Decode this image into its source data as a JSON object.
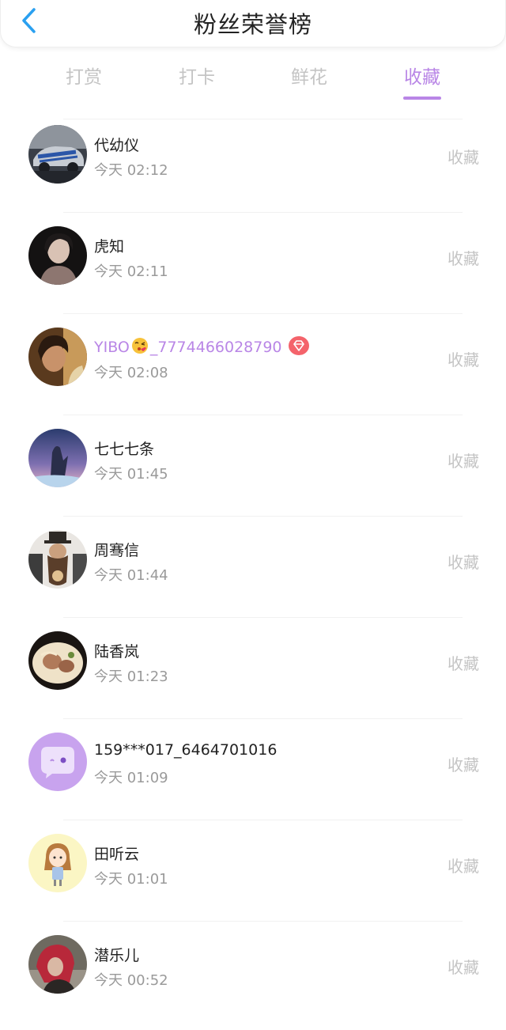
{
  "header": {
    "title": "粉丝荣誉榜"
  },
  "tabs": [
    {
      "label": "打赏",
      "active": false
    },
    {
      "label": "打卡",
      "active": false
    },
    {
      "label": "鲜花",
      "active": false
    },
    {
      "label": "收藏",
      "active": true
    }
  ],
  "colors": {
    "accent": "#b986e6",
    "back": "#2aa0f0",
    "muted": "#c4c4c4"
  },
  "fans": [
    {
      "name": "代幼仪",
      "time": "今天 02:12",
      "action": "收藏",
      "avatar": "car-avatar"
    },
    {
      "name": "虎知",
      "time": "今天 02:11",
      "action": "收藏",
      "avatar": "portrait-dark-avatar"
    },
    {
      "name_prefix": "YIBO",
      "name_suffix": "_7774466028790",
      "emoji": "kiss-emoji-icon",
      "badge": "diamond-badge-icon",
      "time": "今天 02:08",
      "action": "收藏",
      "vip": true,
      "avatar": "portrait-warm-avatar"
    },
    {
      "name": "七七七条",
      "time": "今天 01:45",
      "action": "收藏",
      "avatar": "anime-sky-avatar"
    },
    {
      "name": "周骞信",
      "time": "今天 01:44",
      "action": "收藏",
      "avatar": "bearded-man-avatar"
    },
    {
      "name": "陆香岚",
      "time": "今天 01:23",
      "action": "收藏",
      "avatar": "noodle-bowl-avatar"
    },
    {
      "name": "159***017_6464701016",
      "time": "今天 01:09",
      "action": "收藏",
      "avatar": "default-chat-avatar"
    },
    {
      "name": "田听云",
      "time": "今天 01:01",
      "action": "收藏",
      "avatar": "cartoon-girl-avatar"
    },
    {
      "name": "潜乐儿",
      "time": "今天 00:52",
      "action": "收藏",
      "avatar": "red-hair-avatar"
    }
  ]
}
